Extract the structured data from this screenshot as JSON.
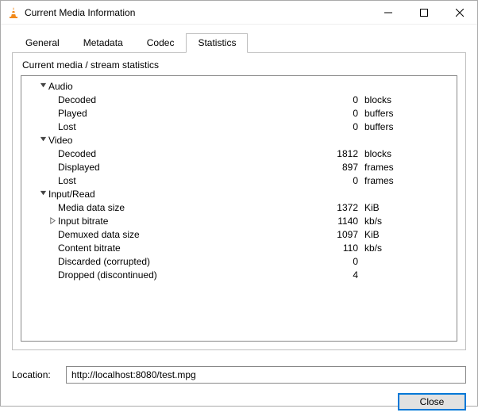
{
  "window": {
    "title": "Current Media Information"
  },
  "tabs": {
    "general": "General",
    "metadata": "Metadata",
    "codec": "Codec",
    "statistics": "Statistics"
  },
  "subtitle": "Current media / stream statistics",
  "stats": {
    "audio": {
      "label": "Audio",
      "decoded": {
        "label": "Decoded",
        "value": "0",
        "unit": "blocks"
      },
      "played": {
        "label": "Played",
        "value": "0",
        "unit": "buffers"
      },
      "lost": {
        "label": "Lost",
        "value": "0",
        "unit": "buffers"
      }
    },
    "video": {
      "label": "Video",
      "decoded": {
        "label": "Decoded",
        "value": "1812",
        "unit": "blocks"
      },
      "displayed": {
        "label": "Displayed",
        "value": "897",
        "unit": "frames"
      },
      "lost": {
        "label": "Lost",
        "value": "0",
        "unit": "frames"
      }
    },
    "input": {
      "label": "Input/Read",
      "media_size": {
        "label": "Media data size",
        "value": "1372",
        "unit": "KiB"
      },
      "input_bitrate": {
        "label": "Input bitrate",
        "value": "1140",
        "unit": "kb/s"
      },
      "demuxed_size": {
        "label": "Demuxed data size",
        "value": "1097",
        "unit": "KiB"
      },
      "content_bitrate": {
        "label": "Content bitrate",
        "value": "110",
        "unit": "kb/s"
      },
      "discarded": {
        "label": "Discarded (corrupted)",
        "value": "0",
        "unit": ""
      },
      "dropped": {
        "label": "Dropped (discontinued)",
        "value": "4",
        "unit": ""
      }
    }
  },
  "location": {
    "label": "Location:",
    "value": "http://localhost:8080/test.mpg"
  },
  "buttons": {
    "close": "Close"
  }
}
